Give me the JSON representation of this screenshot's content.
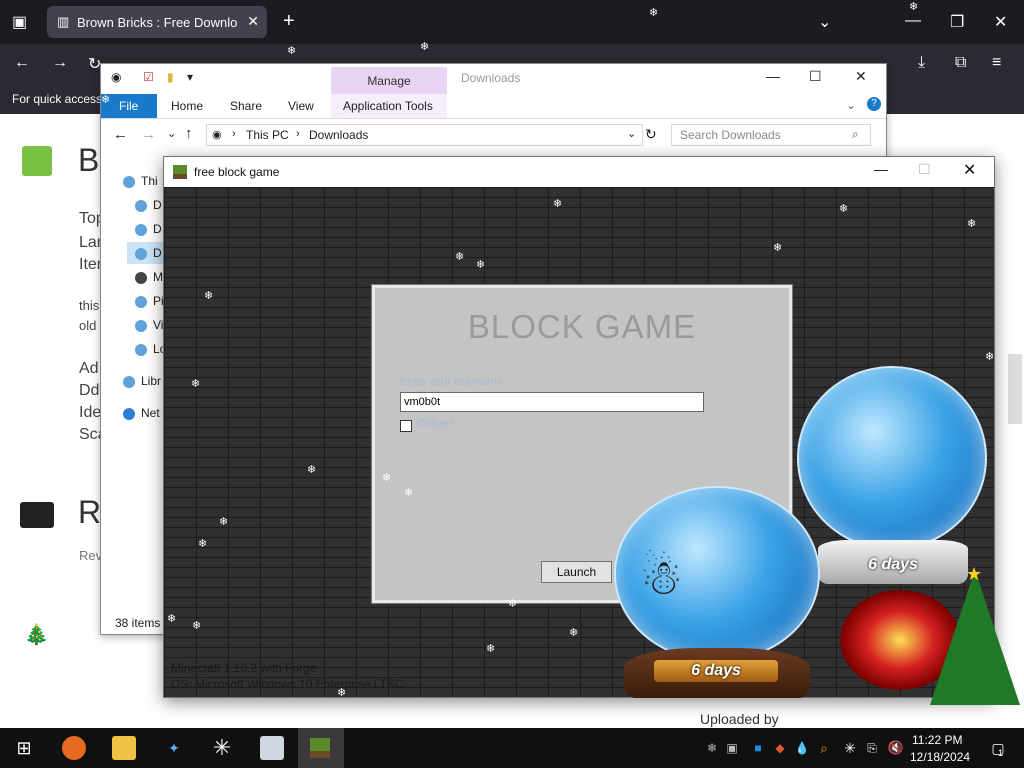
{
  "browser": {
    "tab_title": "Brown Bricks : Free Download, :",
    "tab_close": "✕",
    "new_tab": "+",
    "bookmarks_text": "For quick access,"
  },
  "webpage": {
    "heading1": "B",
    "lines": [
      "Top",
      "Lar",
      "Iter",
      "this",
      "old",
      "Ad",
      "Ddt",
      "Ide",
      "Sca"
    ],
    "heading2": "R",
    "rev": "Rev",
    "uploaded_by": "Uploaded by"
  },
  "explorer": {
    "manage_tab": "Manage",
    "title": "Downloads",
    "ribbon": {
      "file": "File",
      "home": "Home",
      "share": "Share",
      "view": "View",
      "app_tools": "Application Tools"
    },
    "address": {
      "this_pc": "This PC",
      "folder": "Downloads",
      "search_placeholder": "Search Downloads"
    },
    "nav": [
      {
        "label": "Thi"
      },
      {
        "label": "D"
      },
      {
        "label": "D"
      },
      {
        "label": "D"
      },
      {
        "label": "M"
      },
      {
        "label": "Pi"
      },
      {
        "label": "Vi"
      },
      {
        "label": "Lo"
      },
      {
        "label": "Libr"
      },
      {
        "label": "Net"
      }
    ],
    "status_items": "38 items"
  },
  "game": {
    "window_title": "free block game",
    "launcher_title": "BLOCK GAME",
    "username_label": "Enter your username",
    "username_value": "vm0b0t",
    "checkbox_label": "Offline?",
    "launch_label": "Launch",
    "footer_line1": "Minecraft 1.10.2 with Forge",
    "footer_line2": "OS: Microsoft Windows 10 Enterprise LTSC"
  },
  "decor": {
    "globe_days_1": "6 days",
    "globe_days_2": "6 days"
  },
  "taskbar": {
    "time": "11:22 PM",
    "date": "12/18/2024",
    "notification_count": "1"
  }
}
